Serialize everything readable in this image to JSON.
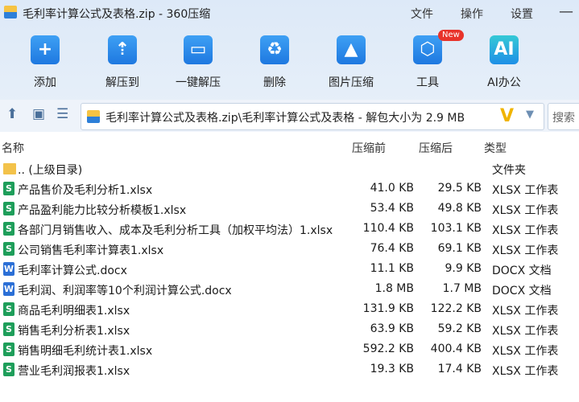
{
  "window": {
    "title": "毛利率计算公式及表格.zip - 360压缩",
    "menu": [
      "文件",
      "操作",
      "设置"
    ]
  },
  "toolbar": [
    {
      "label": "添加",
      "icon": "add-icon"
    },
    {
      "label": "解压到",
      "icon": "extract-to-icon"
    },
    {
      "label": "一键解压",
      "icon": "one-click-extract-icon"
    },
    {
      "label": "删除",
      "icon": "delete-icon"
    },
    {
      "label": "图片压缩",
      "icon": "image-compress-icon"
    },
    {
      "label": "工具",
      "icon": "tools-icon",
      "badge": "New"
    },
    {
      "label": "AI办公",
      "icon": "ai-office-icon"
    }
  ],
  "navbar": {
    "path": "毛利率计算公式及表格.zip\\毛利率计算公式及表格 - 解包大小为 2.9 MB",
    "search_placeholder": "搜索"
  },
  "columns": {
    "name": "名称",
    "compressed": "压缩前",
    "original": "压缩后",
    "type": "类型"
  },
  "files": [
    {
      "name": ".. (上级目录)",
      "compressed": "",
      "original": "",
      "type": "文件夹",
      "kind": "folder"
    },
    {
      "name": "产品售价及毛利分析1.xlsx",
      "compressed": "41.0 KB",
      "original": "29.5 KB",
      "type": "XLSX 工作表",
      "kind": "xlsx"
    },
    {
      "name": "产品盈利能力比较分析模板1.xlsx",
      "compressed": "53.4 KB",
      "original": "49.8 KB",
      "type": "XLSX 工作表",
      "kind": "xlsx"
    },
    {
      "name": "各部门月销售收入、成本及毛利分析工具（加权平均法）1.xlsx",
      "compressed": "110.4 KB",
      "original": "103.1 KB",
      "type": "XLSX 工作表",
      "kind": "xlsx"
    },
    {
      "name": "公司销售毛利率计算表1.xlsx",
      "compressed": "76.4 KB",
      "original": "69.1 KB",
      "type": "XLSX 工作表",
      "kind": "xlsx"
    },
    {
      "name": "毛利率计算公式.docx",
      "compressed": "11.1 KB",
      "original": "9.9 KB",
      "type": "DOCX 文档",
      "kind": "docx"
    },
    {
      "name": "毛利润、利润率等10个利润计算公式.docx",
      "compressed": "1.8 MB",
      "original": "1.7 MB",
      "type": "DOCX 文档",
      "kind": "docx"
    },
    {
      "name": "商品毛利明细表1.xlsx",
      "compressed": "131.9 KB",
      "original": "122.2 KB",
      "type": "XLSX 工作表",
      "kind": "xlsx"
    },
    {
      "name": "销售毛利分析表1.xlsx",
      "compressed": "63.9 KB",
      "original": "59.2 KB",
      "type": "XLSX 工作表",
      "kind": "xlsx"
    },
    {
      "name": "销售明细毛利统计表1.xlsx",
      "compressed": "592.2 KB",
      "original": "400.4 KB",
      "type": "XLSX 工作表",
      "kind": "xlsx"
    },
    {
      "name": "营业毛利润报表1.xlsx",
      "compressed": "19.3 KB",
      "original": "17.4 KB",
      "type": "XLSX 工作表",
      "kind": "xlsx"
    }
  ]
}
